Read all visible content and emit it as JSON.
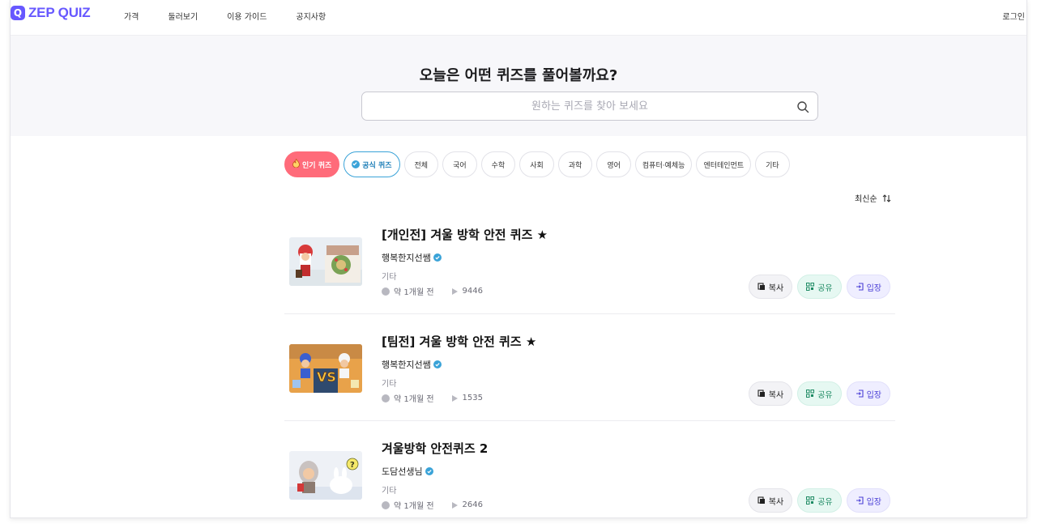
{
  "header": {
    "logo": "ZEP QUIZ",
    "logo_mark": "Q",
    "nav": [
      "가격",
      "둘러보기",
      "이용 가이드",
      "공지사항"
    ],
    "login": "로그인"
  },
  "hero": {
    "title": "오늘은 어떤 퀴즈를 풀어볼까요?",
    "search_placeholder": "원하는 퀴즈를 찾아 보세요"
  },
  "categories": [
    "인기 퀴즈",
    "공식 퀴즈",
    "전체",
    "국어",
    "수학",
    "사회",
    "과학",
    "영어",
    "컴퓨터·예체능",
    "엔터테인먼트",
    "기타"
  ],
  "sort": {
    "label": "최신순"
  },
  "buttons": {
    "copy": "복사",
    "share": "공유",
    "enter": "입장"
  },
  "quizzes": [
    {
      "title": "[개인전] 겨울 방학 안전 퀴즈 ★",
      "author": "행복한지선쌤",
      "category": "기타",
      "time": "약 1개월 전",
      "plays": "9446"
    },
    {
      "title": "[팀전] 겨울 방학 안전 퀴즈 ★",
      "author": "행복한지선쌤",
      "category": "기타",
      "time": "약 1개월 전",
      "plays": "1535"
    },
    {
      "title": "겨울방학 안전퀴즈 2",
      "author": "도담선생님",
      "category": "기타",
      "time": "약 1개월 전",
      "plays": "2646"
    }
  ],
  "colors": {
    "brand": "#6758ff",
    "popular": "#ff6b7a",
    "verified": "#3aa3d8",
    "share": "#1d8a63",
    "enter": "#4a3fd6"
  },
  "icons": {
    "search": "search-icon",
    "sort": "sort-arrows-icon",
    "copy": "copy-icon",
    "share": "qr-icon",
    "enter": "enter-icon"
  }
}
